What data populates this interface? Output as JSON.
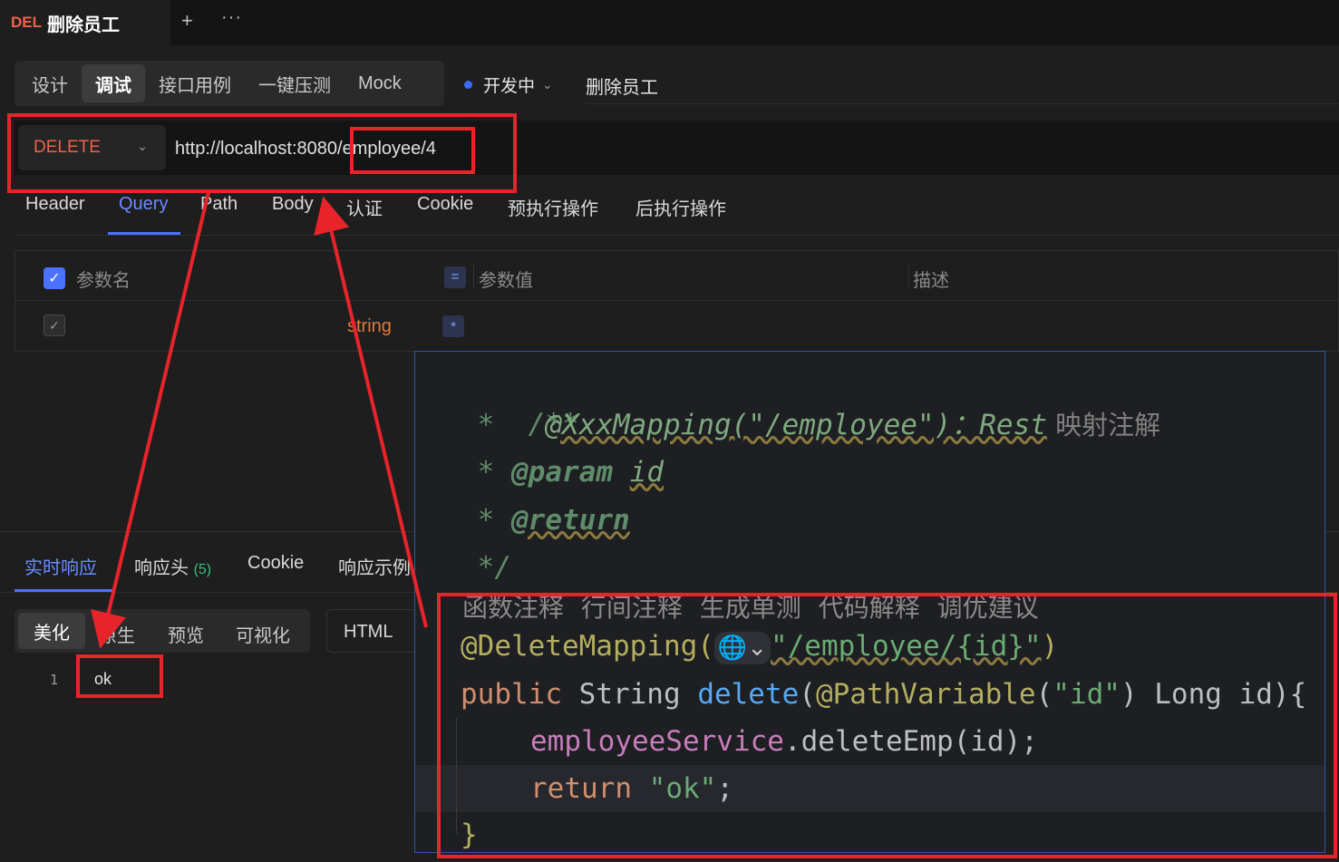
{
  "tab": {
    "method": "DEL",
    "title": "删除员工",
    "add_icon": "+",
    "more_icon": "···"
  },
  "modes": {
    "design": "设计",
    "debug": "调试",
    "stress": "接口用例",
    "one_click": "一键压测",
    "mock": "Mock"
  },
  "status": {
    "label": "开发中",
    "chevron": "⌄",
    "color": "#3a6cff"
  },
  "api_name": "删除员工",
  "request": {
    "method": "DELETE",
    "method_chevron": "⌄",
    "url": "http://localhost:8080/employee/4",
    "method_color": "#f0614c"
  },
  "param_tabs": {
    "header": "Header",
    "query": "Query",
    "path": "Path",
    "body": "Body",
    "auth": "认证",
    "cookie": "Cookie",
    "pre": "预执行操作",
    "post": "后执行操作"
  },
  "param_table": {
    "col_name": "参数名",
    "col_value": "参数值",
    "col_desc": "描述",
    "row_type": "string",
    "eq_symbol": "=",
    "star_symbol": "*",
    "check_on": "✓",
    "check_off": "✓"
  },
  "response_tabs": {
    "live": "实时响应",
    "headers": "响应头",
    "headers_count": "(5)",
    "cookie": "Cookie",
    "example": "响应示例"
  },
  "view_modes": {
    "pretty": "美化",
    "raw": "原生",
    "preview": "预览",
    "visual": "可视化",
    "format": "HTML"
  },
  "response_body": {
    "line_number": "1",
    "text": "ok"
  },
  "code": {
    "l1": "/**",
    "l2_star": " *   ",
    "l2_tag": "@XxxMapping(\"/employee\")：Rest",
    "l2_cn": " 映射注解",
    "l3_star": " * ",
    "l3_tag": "@param",
    "l3_val": "id",
    "l4_star": " * ",
    "l4_tag": "@return",
    "l5": " */",
    "hints": "函数注释 行间注释 生成单测 代码解释 调优建议",
    "l6_ann": "@DeleteMapping(",
    "l6_globe": "🌐⌄",
    "l6_str": "\"/employee/{id}\"",
    "l6_end": ")",
    "l7_kw": "public ",
    "l7_type": "String ",
    "l7_fn": "delete",
    "l7_p1": "(",
    "l7_ann": "@PathVariable",
    "l7_p2": "(",
    "l7_str": "\"id\"",
    "l7_p3": ") Long id){",
    "l8_field": "employeeService",
    "l8_rest": ".deleteEmp(id);",
    "l9_kw": "return ",
    "l9_str": "\"ok\"",
    "l9_end": ";",
    "l10": "}"
  }
}
